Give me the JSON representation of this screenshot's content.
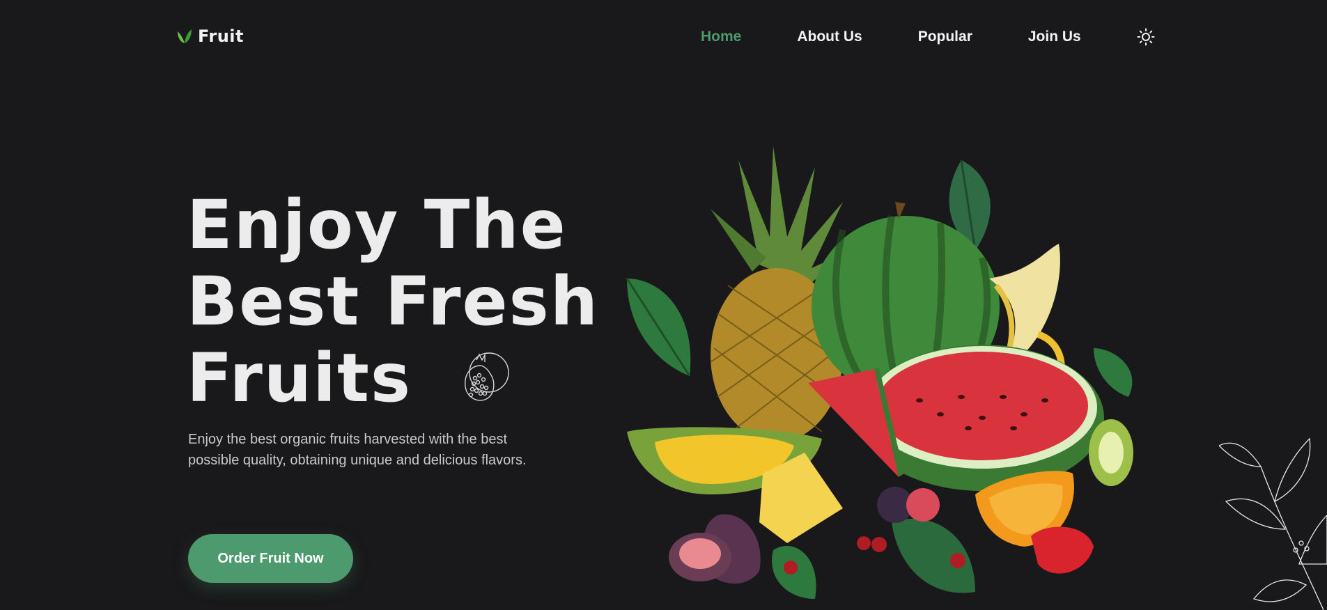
{
  "brand": {
    "name": "Fruit",
    "icon": "leaf-icon",
    "accent": "#4e9a6f"
  },
  "nav": {
    "items": [
      {
        "label": "Home",
        "active": true
      },
      {
        "label": "About Us",
        "active": false
      },
      {
        "label": "Popular",
        "active": false
      },
      {
        "label": "Join Us",
        "active": false
      }
    ],
    "theme_icon": "sun-icon"
  },
  "hero": {
    "title_line1": "Enjoy The",
    "title_line2": "Best Fresh",
    "title_line3": "Fruits",
    "description": "Enjoy the best organic fruits harvested with the best possible quality, obtaining unique and delicious flavors.",
    "cta_label": "Order Fruit Now"
  },
  "colors": {
    "background": "#19181a",
    "text": "#ececec",
    "accent": "#4e9a6f"
  }
}
